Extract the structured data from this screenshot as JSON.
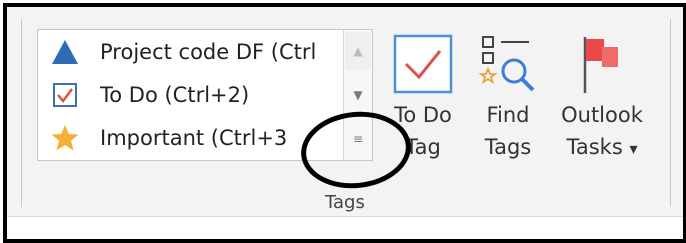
{
  "gallery": {
    "items": [
      {
        "label": "Project code DF (Ctrl",
        "icon": "blue-triangle-icon"
      },
      {
        "label": "To Do (Ctrl+2)",
        "icon": "checkbox-checked-icon"
      },
      {
        "label": "Important (Ctrl+3",
        "icon": "star-icon"
      }
    ],
    "scroll_up_glyph": "▲",
    "scroll_down_glyph": "▼",
    "more_glyph": "≡"
  },
  "buttons": {
    "todo_tag": {
      "line1": "To Do",
      "line2": "Tag",
      "icon": "todo-checkbox-icon"
    },
    "find_tags": {
      "line1": "Find",
      "line2": "Tags",
      "icon": "find-tags-icon"
    },
    "outlook_tasks": {
      "line1": "Outlook",
      "line2": "Tasks",
      "dropdown_glyph": "▾",
      "icon": "red-flag-icon"
    }
  },
  "group": {
    "label": "Tags"
  },
  "colors": {
    "triangle_blue": "#2e6db4",
    "check_red": "#d9534f",
    "star_gold": "#f2b134",
    "flag_red": "#e8494a",
    "magnifier_blue": "#3b7dd8"
  },
  "annotation": {
    "shape": "hand-drawn-ellipse",
    "color": "#000000"
  }
}
